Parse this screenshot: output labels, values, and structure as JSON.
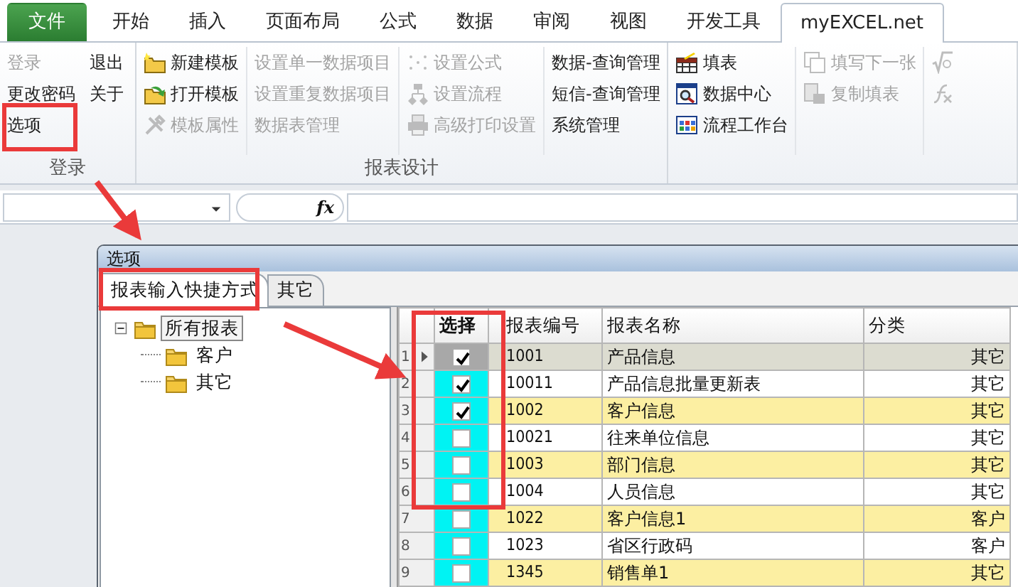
{
  "ribbon_tabs": [
    {
      "label": "文件",
      "kind": "file",
      "selected": false
    },
    {
      "label": "开始",
      "kind": "tab",
      "selected": false
    },
    {
      "label": "插入",
      "kind": "tab",
      "selected": false
    },
    {
      "label": "页面布局",
      "kind": "tab",
      "selected": false
    },
    {
      "label": "公式",
      "kind": "tab",
      "selected": false
    },
    {
      "label": "数据",
      "kind": "tab",
      "selected": false
    },
    {
      "label": "审阅",
      "kind": "tab",
      "selected": false
    },
    {
      "label": "视图",
      "kind": "tab",
      "selected": false
    },
    {
      "label": "开发工具",
      "kind": "tab",
      "selected": false
    },
    {
      "label": "myEXCEL.net",
      "kind": "tab",
      "selected": true
    }
  ],
  "ribbon_groups": [
    {
      "label": "登录",
      "columns": [
        [
          {
            "label": "登录",
            "disabled": true
          },
          {
            "label": "更改密码",
            "disabled": false
          },
          {
            "label": "选项",
            "disabled": false
          }
        ],
        [
          {
            "label": "退出",
            "disabled": false
          },
          {
            "label": "关于",
            "disabled": false
          }
        ]
      ]
    },
    {
      "label": "报表设计",
      "columns": [
        [
          {
            "label": "新建模板",
            "disabled": false
          },
          {
            "label": "打开模板",
            "disabled": false
          },
          {
            "label": "模板属性",
            "disabled": true
          }
        ],
        [
          {
            "label": "设置单一数据项目",
            "disabled": true
          },
          {
            "label": "设置重复数据项目",
            "disabled": true
          },
          {
            "label": "数据表管理",
            "disabled": true
          }
        ],
        [
          {
            "label": "设置公式",
            "disabled": true
          },
          {
            "label": "设置流程",
            "disabled": true
          },
          {
            "label": "高级打印设置",
            "disabled": true
          }
        ],
        [
          {
            "label": "数据-查询管理",
            "disabled": false
          },
          {
            "label": "短信-查询管理",
            "disabled": false
          },
          {
            "label": "系统管理",
            "disabled": false
          }
        ]
      ]
    },
    {
      "columns": [
        [
          {
            "label": "填表",
            "disabled": false
          },
          {
            "label": "数据中心",
            "disabled": false
          },
          {
            "label": "流程工作台",
            "disabled": false
          }
        ],
        [
          {
            "label": "填写下一张",
            "disabled": true
          },
          {
            "label": "复制填表",
            "disabled": true
          }
        ],
        [
          {
            "disabled": true
          },
          {
            "disabled": true
          }
        ]
      ]
    }
  ],
  "formula_bar": {
    "fx": "fx"
  },
  "dialog": {
    "title": "选项",
    "tabs": [
      {
        "label": "报表输入快捷方式",
        "selected": true
      },
      {
        "label": "其它",
        "selected": false
      }
    ],
    "tree": [
      {
        "label": "所有报表",
        "expanded": true,
        "selected": true,
        "children": [
          {
            "label": "客户",
            "selected": false
          },
          {
            "label": "其它",
            "selected": false
          }
        ]
      }
    ],
    "grid": {
      "columns": [
        "选择",
        "报表编号",
        "报表名称",
        "分类"
      ],
      "rows": [
        {
          "number": "1",
          "checked": true,
          "code": "1001",
          "name": "产品信息",
          "category": "其它",
          "selected": true
        },
        {
          "number": "2",
          "checked": true,
          "code": "10011",
          "name": "产品信息批量更新表",
          "category": "其它",
          "selected": false
        },
        {
          "number": "3",
          "checked": true,
          "code": "1002",
          "name": "客户信息",
          "category": "其它",
          "selected": false
        },
        {
          "number": "4",
          "checked": false,
          "code": "10021",
          "name": "往来单位信息",
          "category": "其它",
          "selected": false
        },
        {
          "number": "5",
          "checked": false,
          "code": "1003",
          "name": "部门信息",
          "category": "其它",
          "selected": false
        },
        {
          "number": "6",
          "checked": false,
          "code": "1004",
          "name": "人员信息",
          "category": "其它",
          "selected": false
        },
        {
          "number": "7",
          "checked": false,
          "code": "1022",
          "name": "客户信息1",
          "category": "客户",
          "selected": false
        },
        {
          "number": "8",
          "checked": false,
          "code": "1023",
          "name": "省区行政码",
          "category": "客户",
          "selected": false
        },
        {
          "number": "9",
          "checked": false,
          "code": "1345",
          "name": "销售单1",
          "category": "其它",
          "selected": false
        }
      ]
    }
  }
}
